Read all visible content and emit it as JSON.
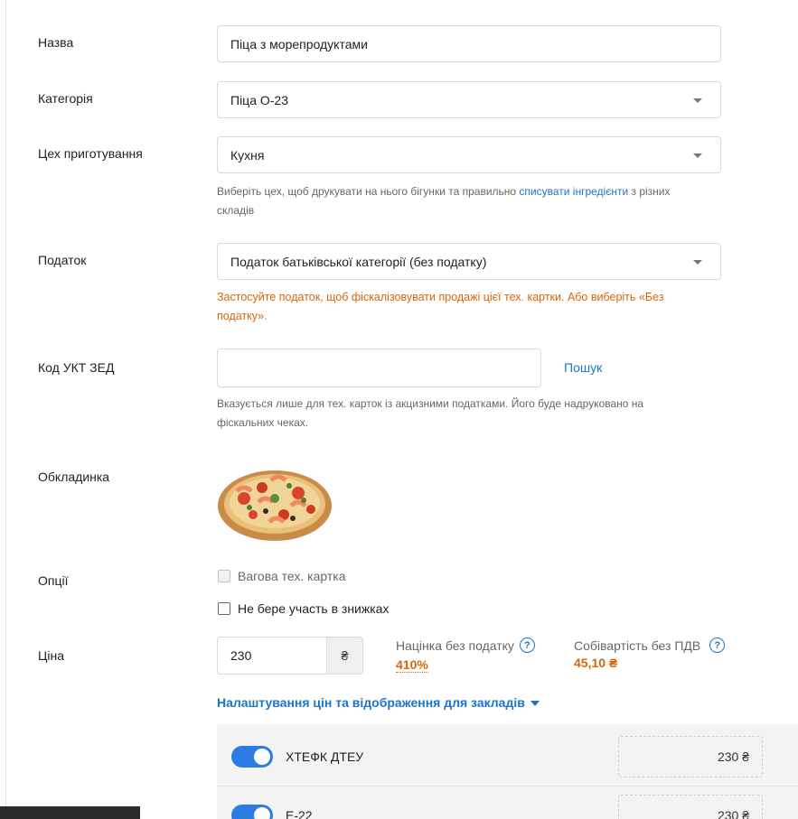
{
  "form": {
    "name": {
      "label": "Назва",
      "value": "Піца з морепродуктами"
    },
    "category": {
      "label": "Категорія",
      "value": "Піца О-23"
    },
    "workshop": {
      "label": "Цех приготування",
      "value": "Кухня",
      "hint_part1": "Виберіть цех, щоб друкувати на нього бігунки та правильно ",
      "hint_link": "списувати інгредієнти",
      "hint_part2": " з різних складів"
    },
    "tax": {
      "label": "Податок",
      "value": "Податок батьківської категорії (без податку)",
      "warning": "Застосуйте податок, щоб фіскалізовувати продажі цієї тех. картки. Або виберіть «Без податку»."
    },
    "uktzed": {
      "label": "Код УКТ ЗЕД",
      "value": "",
      "search_label": "Пошук",
      "hint": "Вказується лише для тех. карток із акцизними податками. Його буде надруковано на фіскальних чеках."
    },
    "cover": {
      "label": "Обкладинка"
    },
    "options": {
      "label": "Опції",
      "weight_card": "Вагова тех. картка",
      "no_discounts": "Не бере участь в знижках"
    },
    "price": {
      "label": "Ціна",
      "value": "230",
      "currency": "₴",
      "markup_label": "Націнка без податку",
      "markup_value": "410%",
      "cost_label": "Собівартість без ПДВ",
      "cost_value": "45,10 ₴"
    },
    "settings_link": "Налаштування цін та відображення для закладів",
    "venues": [
      {
        "name": "ХТЕФК ДТЕУ",
        "price": "230 ₴",
        "enabled": true
      },
      {
        "name": "Е-22",
        "price": "230 ₴",
        "enabled": true
      }
    ]
  },
  "colors": {
    "accent": "#1b74c9",
    "warning": "#d9650b",
    "toggle": "#2d7be5"
  },
  "icons": {
    "caret": "chevron-down-icon",
    "help": "question-circle-icon"
  }
}
